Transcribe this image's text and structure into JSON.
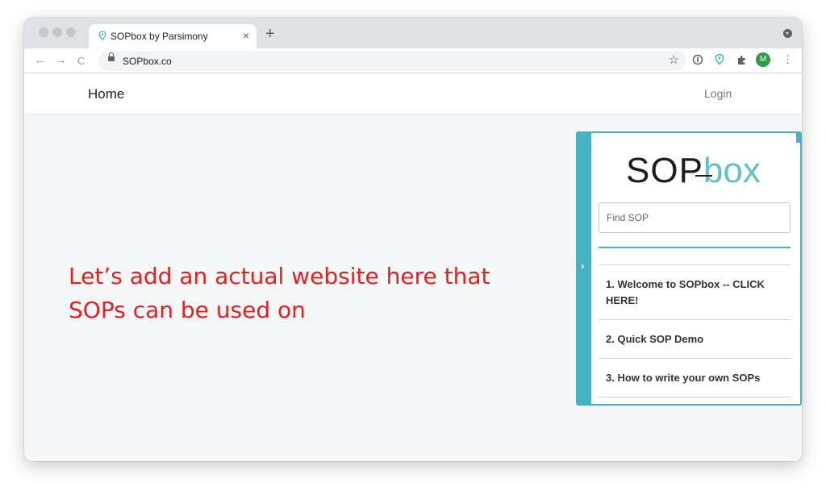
{
  "browser": {
    "tab_title": "SOPbox by Parsimony",
    "tab_close": "×",
    "new_tab": "+",
    "url": "SOPbox.co",
    "avatar_initial": "M",
    "back_icon": "←",
    "forward_icon": "→",
    "reload_icon": "C",
    "star_icon": "☆",
    "menu_icon": "⋮"
  },
  "site": {
    "nav_home": "Home",
    "nav_login": "Login"
  },
  "annotation": {
    "text": "Let’s add an actual website here that SOPs can be used on",
    "color": "#e32020"
  },
  "widget": {
    "logo_part1": "SOP",
    "logo_part2": "box",
    "search_placeholder": "Find SOP",
    "accent_color": "#45b4c0",
    "items": [
      {
        "label": "1. Welcome to SOPbox -- CLICK HERE!"
      },
      {
        "label": "2. Quick SOP Demo"
      },
      {
        "label": "3. How to write your own SOPs"
      }
    ]
  }
}
